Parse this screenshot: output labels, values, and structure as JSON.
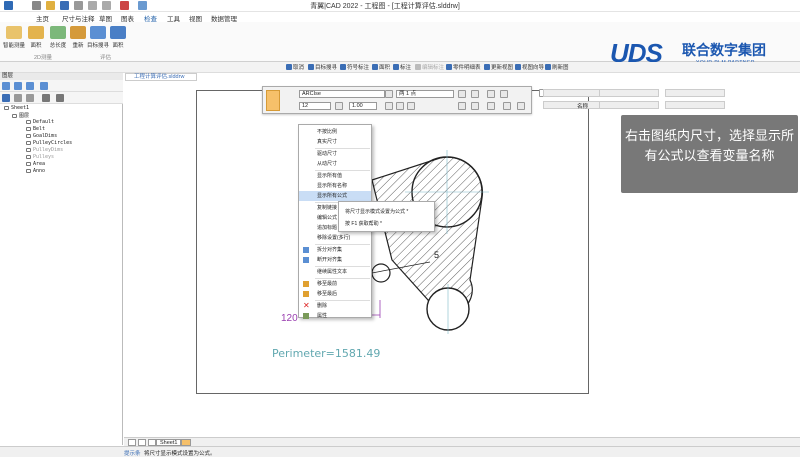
{
  "window": {
    "title": "青翼|CAD 2022 - 工程图 - [工程计算评估.slddrw]"
  },
  "menu": [
    "主页",
    "尺寸与注释",
    "草图",
    "图表",
    "检查",
    "工具",
    "视图",
    "数据管理"
  ],
  "menu_active_index": 4,
  "ribbon": {
    "buttons": [
      "智能测量",
      "面积",
      "总长度",
      "重新",
      "目标搜寻",
      "面积"
    ],
    "groups": [
      "2D测量",
      "评估"
    ]
  },
  "logo": {
    "brand": "UDS",
    "name": "联合数字集团",
    "tagline": "YOUR PLM PARTNER"
  },
  "cmdbar": [
    "取消",
    "目标搜寻",
    "符号标注",
    "面积",
    "标注",
    "编辑标注",
    "零件明细表",
    "更新视图",
    "视图向导",
    "刷新图"
  ],
  "left_panel": {
    "title": "图层",
    "tree": [
      {
        "label": "Sheet1",
        "dim": false
      },
      {
        "label": "图层",
        "dim": false
      },
      {
        "label": "Default",
        "dim": false
      },
      {
        "label": "Belt",
        "dim": false
      },
      {
        "label": "GoalDims",
        "dim": false
      },
      {
        "label": "PulleyCircles",
        "dim": false
      },
      {
        "label": "PulleyDims",
        "dim": true
      },
      {
        "label": "Pulleys",
        "dim": true
      },
      {
        "label": "Area",
        "dim": false
      },
      {
        "label": "Anno",
        "dim": false
      }
    ]
  },
  "doc_tab": "工程计算评估.slddrw",
  "float_toolbar": {
    "font": "ARCIse",
    "size": "12",
    "scale": "1.00",
    "layer": "两 1 点"
  },
  "props": {
    "name_label": "名称"
  },
  "tooltip": "右击图纸内尺寸，选择显示所有公式以查看变量名称",
  "context_menu": [
    {
      "label": "不按比例",
      "dis": false
    },
    {
      "label": "真实尺寸",
      "dis": false
    },
    {
      "label": "驱动尺寸",
      "dis": false
    },
    {
      "label": "从动尺寸",
      "dis": false
    },
    {
      "label": "显示所有值",
      "dis": false
    },
    {
      "label": "显示所有名称",
      "dis": false
    },
    {
      "label": "显示所有公式",
      "dis": false
    },
    {
      "label": "复制链接",
      "dis": false
    },
    {
      "label": "编辑公式",
      "dis": false
    },
    {
      "label": "追加标题",
      "dis": false
    },
    {
      "label": "移除设置(多行)",
      "dis": false
    },
    {
      "label": "拆分对齐集",
      "dis": false
    },
    {
      "label": "断开对齐集",
      "dis": false
    },
    {
      "label": "继续属性文本",
      "dis": false
    },
    {
      "label": "移至最前",
      "dis": false
    },
    {
      "label": "移至最后",
      "dis": false
    },
    {
      "label": "删除",
      "dis": false
    },
    {
      "label": "属性",
      "dis": false
    }
  ],
  "submenu": [
    "将尺寸显示模式设置为公式  *",
    "按 F1 获取帮助 *"
  ],
  "drawing": {
    "perimeter": "Perimeter=1581.49",
    "dim_120": "120",
    "dim_5": "5"
  },
  "sheet_tab": "Sheet1",
  "status": {
    "label": "提示条",
    "text": "将尺寸显示模式设置为公式。"
  },
  "colors": {
    "accent": "#1b57b0",
    "tooltip_bg": "#707070",
    "perimeter": "#62a8b0",
    "highlight": "#c9ddf5"
  }
}
